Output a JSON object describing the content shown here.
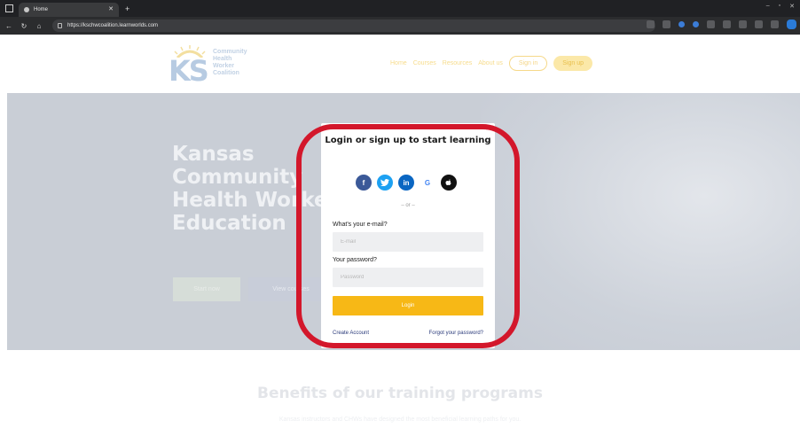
{
  "browser": {
    "tab_title": "Home",
    "url": "https://kschwcoalition.learnworlds.com"
  },
  "logo": {
    "letters": "KS",
    "line1": "Community",
    "line2": "Health",
    "line3": "Worker",
    "line4": "Coalition"
  },
  "nav": {
    "items": [
      "Home",
      "Courses",
      "Resources",
      "About us"
    ],
    "signin": "Sign in",
    "signup": "Sign up"
  },
  "hero": {
    "title": "Kansas Community Health Worker Education",
    "start_button": "Start now",
    "courses_button": "View courses"
  },
  "benefits": {
    "title": "Benefits of our training programs",
    "subtitle": "Kansas instructors and CHWs have designed the most beneficial learning paths for you."
  },
  "modal": {
    "title": "Login or sign up to start learning",
    "or_text": "– or –",
    "email_label": "What's your e-mail?",
    "email_placeholder": "E-mail",
    "password_label": "Your password?",
    "password_placeholder": "Password",
    "login_button": "Login",
    "create_account": "Create Account",
    "forgot_password": "Forgot your password?",
    "social": [
      "f",
      "t",
      "in",
      "G",
      ""
    ]
  },
  "colors": {
    "login_button": "#f7b816",
    "highlight_ring": "#d3172b",
    "facebook": "#3b5998",
    "twitter": "#1da1f2",
    "linkedin": "#0a66c2"
  }
}
